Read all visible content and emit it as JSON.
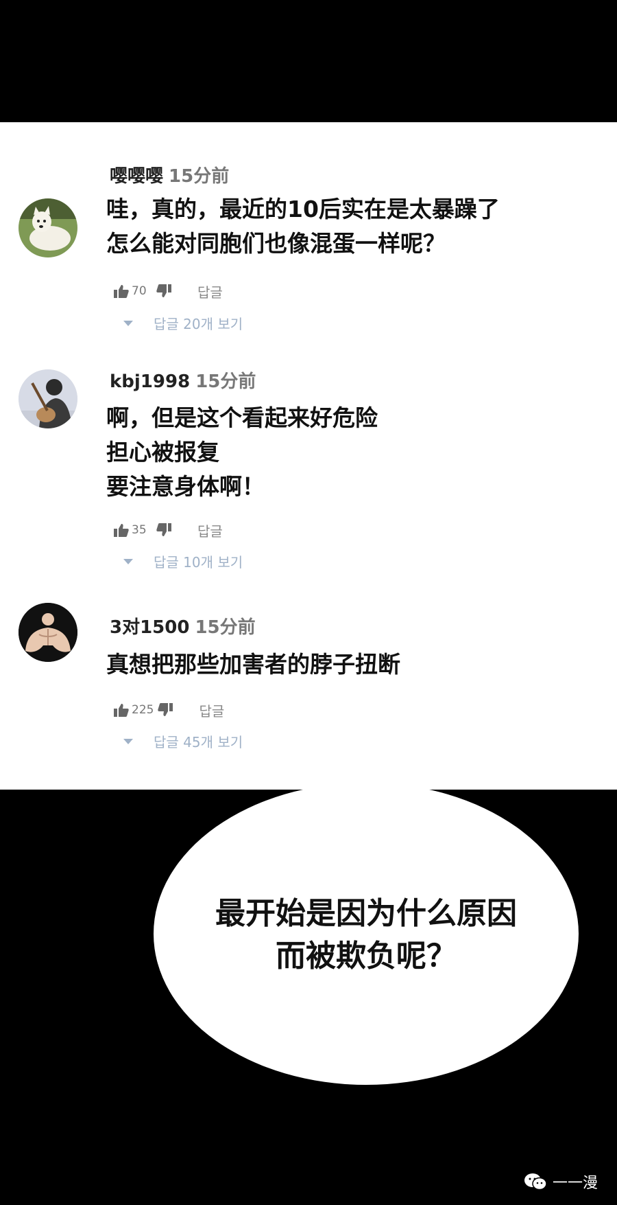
{
  "comments": [
    {
      "username": "嘤嘤嘤",
      "time": "15分前",
      "lines": [
        "哇，真的，最近的10后实在是太暴躁了",
        "怎么能对同胞们也像混蛋一样呢？"
      ],
      "likes": "70",
      "reply_label": "답글",
      "replies_label": "답글 20개 보기",
      "avatar_icon": "dog-avatar"
    },
    {
      "username": "kbj1998",
      "time": "15分前",
      "lines": [
        "啊，但是这个看起来好危险",
        "担心被报复",
        "要注意身体啊！"
      ],
      "likes": "35",
      "reply_label": "답글",
      "replies_label": "답글 10개 보기",
      "avatar_icon": "guitarist-avatar"
    },
    {
      "username": "3对1500",
      "time": "15分前",
      "lines": [
        "真想把那些加害者的脖子扭断"
      ],
      "likes": "225",
      "reply_label": "답글",
      "replies_label": "답글 45개 보기",
      "avatar_icon": "bodybuilder-avatar"
    }
  ],
  "bubble": {
    "lines": [
      "最开始是因为什么原因",
      "而被欺负呢？"
    ]
  },
  "watermark": {
    "icon": "wechat-icon",
    "text": "一一漫"
  },
  "colors": {
    "panel": "#ffffff",
    "background": "#000000",
    "replies_link": "#9fb1c7"
  }
}
